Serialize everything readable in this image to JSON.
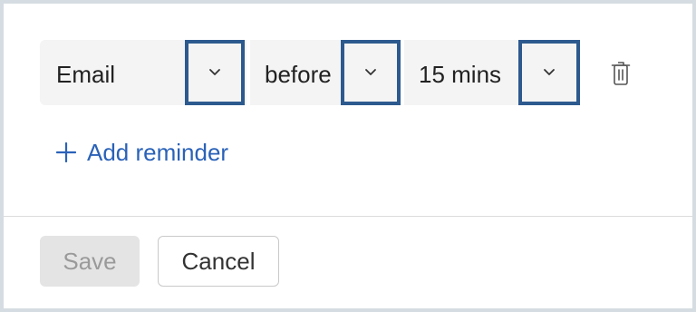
{
  "reminder": {
    "channel": {
      "value": "Email",
      "dropdown_icon": "chevron-down-icon"
    },
    "relation": {
      "value": "before",
      "dropdown_icon": "chevron-down-icon"
    },
    "offset": {
      "value": "15 mins",
      "dropdown_icon": "chevron-down-icon"
    },
    "delete_icon": "trash-icon"
  },
  "add_reminder": {
    "icon": "plus-icon",
    "label": "Add reminder"
  },
  "footer": {
    "save_label": "Save",
    "cancel_label": "Cancel"
  },
  "colors": {
    "highlight_border": "#2d5a8e",
    "link": "#2a62b8",
    "field_bg": "#f4f4f4",
    "disabled_button_bg": "#e4e4e4"
  }
}
